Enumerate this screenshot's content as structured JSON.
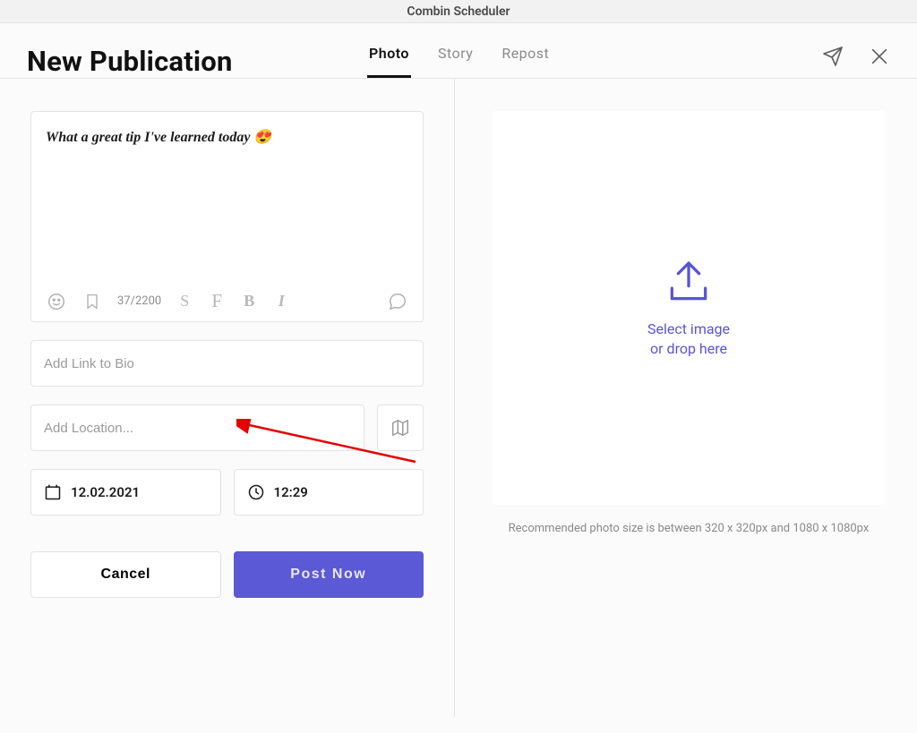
{
  "app_title": "Combin Scheduler",
  "page_title": "New Publication",
  "tabs": [
    {
      "label": "Photo",
      "active": true
    },
    {
      "label": "Story",
      "active": false
    },
    {
      "label": "Repost",
      "active": false
    }
  ],
  "caption": {
    "text": "What a great tip I've learned today 😍",
    "char_count": "37/2200"
  },
  "link_in_bio": {
    "placeholder": "Add Link to Bio",
    "value": ""
  },
  "location": {
    "placeholder": "Add Location...",
    "value": ""
  },
  "date": "12.02.2021",
  "time": "12:29",
  "buttons": {
    "cancel": "Cancel",
    "post": "Post Now"
  },
  "drop_zone": {
    "line1": "Select image",
    "line2": "or drop here",
    "recommended": "Recommended photo size is between 320 x 320px and 1080 x 1080px"
  },
  "colors": {
    "accent": "#5854d6"
  }
}
